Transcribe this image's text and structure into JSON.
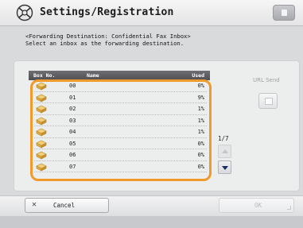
{
  "title": "Settings/Registration",
  "instructions": {
    "line1": "<Forwarding Destination: Confidential Fax Inbox>",
    "line2": "Select an inbox as the forwarding destination."
  },
  "table": {
    "columns": {
      "box_no": "Box No.",
      "name": "Name",
      "used": "Used"
    },
    "rows": [
      {
        "box_no": "00",
        "used": "0%"
      },
      {
        "box_no": "01",
        "used": "9%"
      },
      {
        "box_no": "02",
        "used": "1%"
      },
      {
        "box_no": "03",
        "used": "1%"
      },
      {
        "box_no": "04",
        "used": "1%"
      },
      {
        "box_no": "05",
        "used": "0%"
      },
      {
        "box_no": "06",
        "used": "0%"
      },
      {
        "box_no": "07",
        "used": "0%"
      }
    ]
  },
  "url_send": {
    "label": "URL Send"
  },
  "pagination": {
    "indicator": "1/7"
  },
  "footer": {
    "cancel_label": "Cancel",
    "ok_label": "OK"
  },
  "colors": {
    "selection_frame": "#f09a2c",
    "scroll_arrow": "#1a2b6a",
    "header_bg": "#5a5a5e"
  },
  "icons": {
    "title": "settings-registration-icon",
    "box": "inbox-folder-icon",
    "cancel": "close-icon"
  }
}
